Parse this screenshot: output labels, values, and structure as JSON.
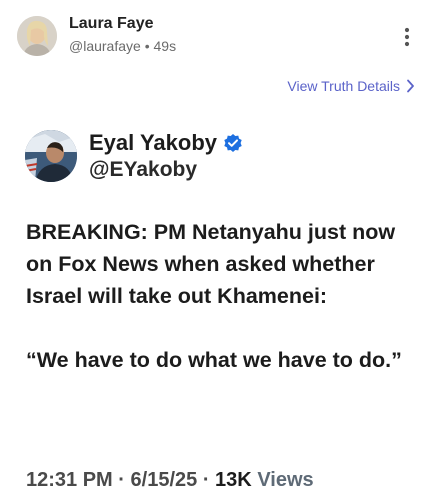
{
  "post": {
    "author_name": "Laura Faye",
    "author_handle": "@laurafaye",
    "separator": "•",
    "time_ago": "49s",
    "more_icon": "vertical-ellipsis-icon",
    "details_link": "View Truth Details",
    "details_icon": "chevron-right-icon"
  },
  "quoted_tweet": {
    "author_name": "Eyal Yakoby",
    "verified_icon": "verified-badge-icon",
    "verified_color": "#1d6fe0",
    "author_handle": "@EYakoby",
    "text_line_1": "BREAKING: PM Netanyahu just now on Fox News when asked whether Israel will take out Khamenei:",
    "text_line_2": "“We have to do what we have to do.”",
    "time": "12:31 PM",
    "date": "6/15/25",
    "views_count": "13K",
    "views_label": "Views",
    "dot": "·"
  },
  "colors": {
    "link": "#5b63c9",
    "meta": "#6b6b6b"
  }
}
